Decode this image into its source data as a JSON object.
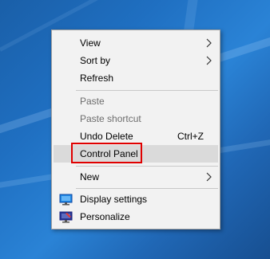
{
  "context_menu": {
    "items": [
      {
        "label": "View",
        "submenu": true,
        "enabled": true
      },
      {
        "label": "Sort by",
        "submenu": true,
        "enabled": true
      },
      {
        "label": "Refresh",
        "enabled": true
      },
      {
        "label": "Paste",
        "enabled": false
      },
      {
        "label": "Paste shortcut",
        "enabled": false
      },
      {
        "label": "Undo Delete",
        "shortcut": "Ctrl+Z",
        "enabled": true
      },
      {
        "label": "Control Panel",
        "enabled": true,
        "hovered": true,
        "annotated": true
      },
      {
        "label": "New",
        "submenu": true,
        "enabled": true
      },
      {
        "label": "Display settings",
        "icon": "display-settings-icon",
        "enabled": true
      },
      {
        "label": "Personalize",
        "icon": "personalize-icon",
        "enabled": true
      }
    ]
  },
  "colors": {
    "annotation_box": "#e00000",
    "menu_background": "#f2f2f2",
    "hover_background": "#dadada",
    "disabled_text": "#6d6d6d"
  }
}
